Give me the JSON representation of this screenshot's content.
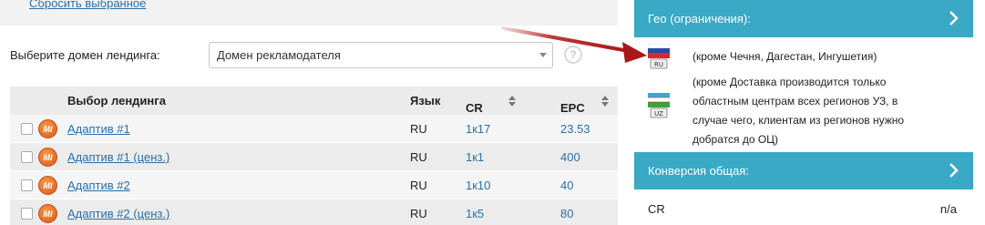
{
  "filters": {
    "reset_label": "Сбросить выбранное",
    "domain_label": "Выберите домен лендинга:",
    "domain_value": "Домен рекламодателя",
    "help_glyph": "?"
  },
  "table": {
    "headers": {
      "landing": "Выбор лендинга",
      "lang": "Язык",
      "cr": "CR",
      "epc": "EPC"
    },
    "rows": [
      {
        "name": "Адаптив #1",
        "lang": "RU",
        "cr": "1к17",
        "epc": "23.53"
      },
      {
        "name": "Адаптив #1 (ценз.)",
        "lang": "RU",
        "cr": "1к1",
        "epc": "400"
      },
      {
        "name": "Адаптив #2",
        "lang": "RU",
        "cr": "1к10",
        "epc": "40"
      },
      {
        "name": "Адаптив #2 (ценз.)",
        "lang": "RU",
        "cr": "1к5",
        "epc": "80"
      }
    ],
    "badge_text": "MI"
  },
  "geo": {
    "header": "Гео (ограничения):",
    "items": [
      {
        "country_code": "RU",
        "text_lines": [
          "(кроме Чечня, Дагестан, Ингушетия)"
        ]
      },
      {
        "country_code": "UZ",
        "text_lines": [
          "(кроме Доставка производится только",
          "областным центрам всех регионов УЗ, в",
          "случае чего, клиентам из регионов нужно",
          "добратся до ОЦ)"
        ]
      }
    ]
  },
  "conversion": {
    "header": "Конверсия общая:",
    "cr_label": "CR",
    "cr_value": "n/a"
  },
  "colors": {
    "accent": "#39a9c6",
    "link": "#2a6fa8",
    "arrow": "#b51e1e",
    "badge": "#e36a23"
  },
  "icons": [
    "chevron-right-icon",
    "help-icon",
    "mi-badge-icon",
    "flag-ru-icon",
    "flag-uz-icon",
    "sort-icon",
    "annotation-arrow-icon"
  ]
}
